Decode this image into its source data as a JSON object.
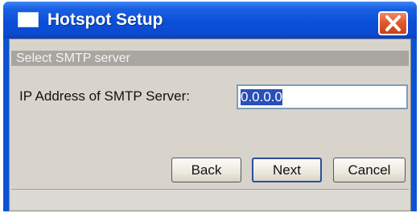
{
  "window": {
    "title": "Hotspot Setup",
    "icons": {
      "app": "window-icon",
      "close": "close-icon"
    },
    "colors": {
      "titlebar": "#0b4fd8",
      "close_button": "#e15a2e",
      "client": "#d8d4cc"
    }
  },
  "section": {
    "header": "Select SMTP server"
  },
  "form": {
    "ip_label": "IP Address of SMTP Server:",
    "ip_value": "0.0.0.0"
  },
  "buttons": {
    "back": "Back",
    "next": "Next",
    "cancel": "Cancel"
  }
}
